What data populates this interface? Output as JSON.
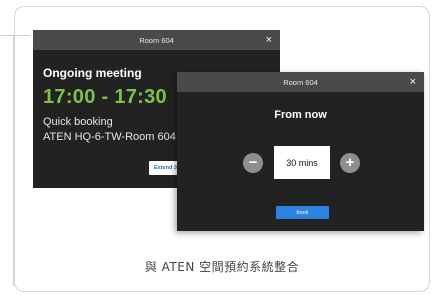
{
  "back_dialog": {
    "title": "Room 604",
    "close": "×",
    "heading": "Ongoing meeting",
    "time": "17:00 - 17:30",
    "booking": "Quick booking",
    "room": "ATEN HQ-6-TW-Room 604",
    "extend_label": "Extend 30"
  },
  "front_dialog": {
    "title": "Room 604",
    "close": "×",
    "heading": "From now",
    "minus": "−",
    "plus": "+",
    "duration": "30 mins",
    "book_label": "book"
  },
  "caption": "與 ATEN 空間預約系統整合",
  "colors": {
    "time_green": "#7cc243",
    "book_blue": "#2b82e0",
    "dialog_bg": "#222222",
    "titlebar_bg": "#4a4a4a"
  }
}
